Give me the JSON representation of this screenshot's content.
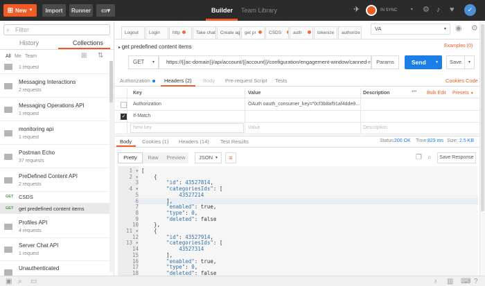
{
  "topbar": {
    "new_label": "New",
    "import_label": "Import",
    "runner_label": "Runner",
    "tabs": [
      "Builder",
      "Team Library"
    ],
    "sync_label": "IN SYNC"
  },
  "sidebar": {
    "filter_placeholder": "Filter",
    "tabs": [
      "History",
      "Collections"
    ],
    "subtabs": [
      "All",
      "Me",
      "Team"
    ],
    "items": [
      {
        "type": "collection",
        "name": "",
        "requests": "1 request"
      },
      {
        "type": "collection",
        "name": "Messaging Interactions",
        "requests": "2 requests"
      },
      {
        "type": "collection",
        "name": "Messaging Operations API",
        "requests": "1 request"
      },
      {
        "type": "collection",
        "name": "monitoring api",
        "requests": "1 request"
      },
      {
        "type": "collection",
        "name": "Postman Echo",
        "requests": "37 requests"
      },
      {
        "type": "collection",
        "name": "PreDefined Content API",
        "requests": "2 requests"
      },
      {
        "type": "request",
        "method": "GET",
        "name": "CSDS"
      },
      {
        "type": "request",
        "method": "GET",
        "name": "get predefined content items"
      },
      {
        "type": "collection",
        "name": "Profiles API",
        "requests": "4 requests"
      },
      {
        "type": "collection",
        "name": "Server Chat API",
        "requests": "1 request"
      },
      {
        "type": "collection",
        "name": "Unauthenticated",
        "requests": ""
      }
    ]
  },
  "request_tabs": [
    "Logout",
    "Login",
    "http",
    "Take chat",
    "Create age",
    "get pr",
    "CSDS",
    "auth",
    "tokenize",
    "authorize"
  ],
  "environment": "VA",
  "request": {
    "title": "get predefined content items",
    "examples": "Examples (0)",
    "method": "GET",
    "url": "https://{{ac-domain}}/api/account/{{account}}/configuration/engagement-window/canned-re...",
    "params_label": "Params",
    "send_label": "Send",
    "save_label": "Save"
  },
  "request_subtabs": [
    "Authorization",
    "Headers (2)",
    "Body",
    "Pre-request Script",
    "Tests"
  ],
  "cookies_label": "Cookies",
  "code_label": "Code",
  "headers_table": {
    "columns": [
      "Key",
      "Value",
      "Description"
    ],
    "bulk_edit": "Bulk Edit",
    "presets": "Presets",
    "rows": [
      {
        "key": "Authorization",
        "value": "OAuth oauth_consumer_key=\"0cf3b8af91af4dde9...",
        "checked": false
      },
      {
        "key": "If-Match",
        "value": "",
        "checked": true
      }
    ],
    "new_key_placeholder": "New key",
    "value_placeholder": "Value",
    "description_placeholder": "Description"
  },
  "response": {
    "tabs": [
      "Body",
      "Cookies (1)",
      "Headers (14)",
      "Test Results"
    ],
    "status_label": "Status:",
    "status_value": "200 OK",
    "time_label": "Time:",
    "time_value": "829 ms",
    "size_label": "Size:",
    "size_value": "2.5 KB",
    "view_tabs": [
      "Pretty",
      "Raw",
      "Preview"
    ],
    "format": "JSON",
    "save_response": "Save Response",
    "lines": [
      {
        "n": "1",
        "t": "["
      },
      {
        "n": "2",
        "t": "    {"
      },
      {
        "n": "3",
        "t": "        \"id\": 43527814,"
      },
      {
        "n": "4",
        "t": "        \"categoriesIds\": ["
      },
      {
        "n": "5",
        "t": "            43527214"
      },
      {
        "n": "6",
        "t": "        ],"
      },
      {
        "n": "7",
        "t": "        \"enabled\": true,"
      },
      {
        "n": "8",
        "t": "        \"type\": 0,"
      },
      {
        "n": "9",
        "t": "        \"deleted\": false"
      },
      {
        "n": "10",
        "t": "    },"
      },
      {
        "n": "11",
        "t": "    {"
      },
      {
        "n": "12",
        "t": "        \"id\": 43527914,"
      },
      {
        "n": "13",
        "t": "        \"categoriesIds\": ["
      },
      {
        "n": "14",
        "t": "            43527314"
      },
      {
        "n": "15",
        "t": "        ],"
      },
      {
        "n": "16",
        "t": "        \"enabled\": true,"
      },
      {
        "n": "17",
        "t": "        \"type\": 0,"
      },
      {
        "n": "18",
        "t": "        \"deleted\": false"
      }
    ]
  },
  "colors": {
    "accent": "#ef5b25",
    "send": "#1a7ee6",
    "topbar": "#2b2b2b",
    "get": "#3fa33f"
  }
}
